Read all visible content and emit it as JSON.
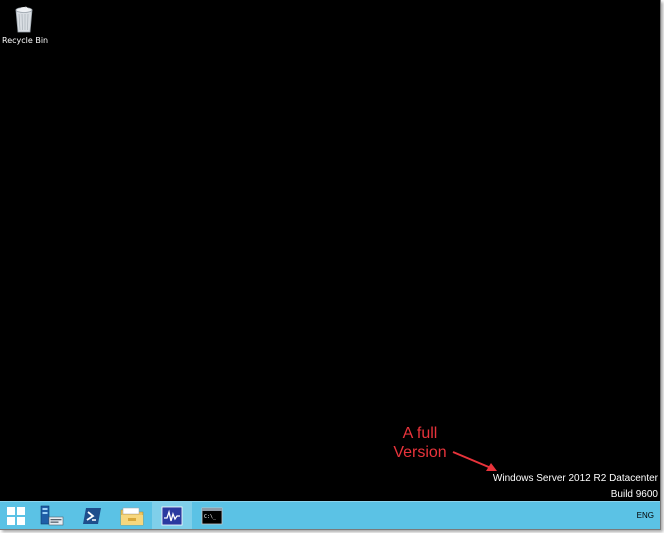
{
  "desktop": {
    "background_color": "#000000",
    "icons": [
      {
        "label": "Recycle Bin",
        "icon": "recycle-bin-icon"
      }
    ]
  },
  "annotation": {
    "text_line1": "A full",
    "text_line2": "Version",
    "color": "#e8333b"
  },
  "watermark": {
    "line1": "Windows Server 2012 R2 Datacenter",
    "line2": "Build 9600"
  },
  "taskbar": {
    "background_color": "#5bc2e5",
    "buttons": [
      {
        "name": "start",
        "icon": "windows-logo-icon"
      },
      {
        "name": "server-manager",
        "icon": "server-manager-icon"
      },
      {
        "name": "powershell",
        "icon": "powershell-icon"
      },
      {
        "name": "file-explorer",
        "icon": "folder-icon"
      },
      {
        "name": "performance-monitor",
        "icon": "performance-monitor-icon"
      },
      {
        "name": "command-prompt",
        "icon": "command-prompt-icon"
      }
    ],
    "tray": {
      "language": "ENG"
    }
  }
}
